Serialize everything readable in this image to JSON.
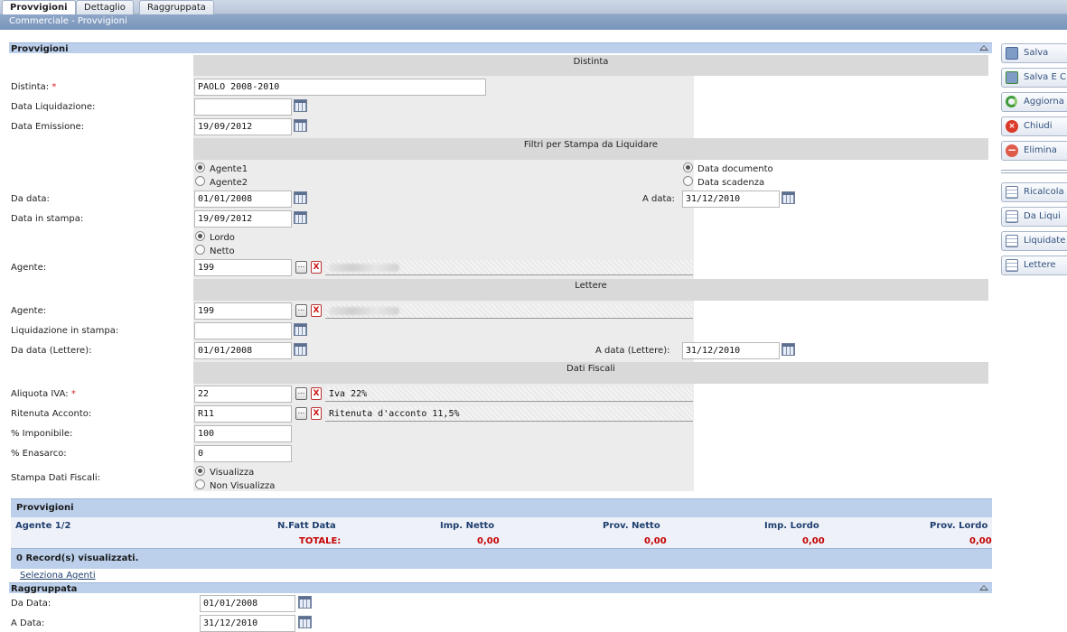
{
  "tabs": [
    {
      "label": "Provvigioni"
    },
    {
      "label": "Dettaglio"
    },
    {
      "label": "Raggruppata"
    }
  ],
  "breadcrumb": "Commerciale - Provvigioni",
  "section_provvigioni": {
    "title": "Provvigioni"
  },
  "groups": {
    "distinta": "Distinta",
    "filtri": "Filtri per Stampa da Liquidare",
    "lettere": "Lettere",
    "dati_fiscali": "Dati Fiscali"
  },
  "form": {
    "distinta_label": "Distinta:",
    "distinta_value": "PAOLO 2008-2010",
    "data_liquidazione_label": "Data Liquidazione:",
    "data_liquidazione_value": "",
    "data_emissione_label": "Data Emissione:",
    "data_emissione_value": "19/09/2012",
    "agente1_label": "Agente1",
    "agente2_label": "Agente2",
    "data_documento_label": "Data documento",
    "data_scadenza_label": "Data scadenza",
    "da_data_label": "Da data:",
    "da_data_value": "01/01/2008",
    "a_data_label": "A data:",
    "a_data_value": "31/12/2010",
    "data_in_stampa_label": "Data in stampa:",
    "data_in_stampa_value": "19/09/2012",
    "lordo_label": "Lordo",
    "netto_label": "Netto",
    "agente_label": "Agente:",
    "agente_value": "199",
    "lettere_agente_label": "Agente:",
    "lettere_agente_value": "199",
    "liquidazione_stampa_label": "Liquidazione in stampa:",
    "liquidazione_stampa_value": "",
    "da_data_lettere_label": "Da data (Lettere):",
    "da_data_lettere_value": "01/01/2008",
    "a_data_lettere_label": "A data (Lettere):",
    "a_data_lettere_value": "31/12/2010",
    "aliquota_iva_label": "Aliquota IVA:",
    "aliquota_iva_value": "22",
    "aliquota_iva_descr": "Iva 22%",
    "ritenuta_label": "Ritenuta Acconto:",
    "ritenuta_value": "R11",
    "ritenuta_descr": "Ritenuta d'acconto 11,5%",
    "imponibile_label": "% Imponibile:",
    "imponibile_value": "100",
    "enasarco_label": "% Enasarco:",
    "enasarco_value": "0",
    "stampa_dati_label": "Stampa Dati Fiscali:",
    "visualizza_label": "Visualizza",
    "non_visualizza_label": "Non Visualizza",
    "required_mark": "*",
    "lookup_glyph": "...",
    "clear_glyph": "X"
  },
  "grid": {
    "title": "Provvigioni",
    "columns": [
      "Agente 1/2",
      "N.Fatt Data",
      "Imp. Netto",
      "Prov. Netto",
      "Imp. Lordo",
      "Prov. Lordo"
    ],
    "totals_label": "TOTALE:",
    "totals": [
      "0,00",
      "0,00",
      "0,00",
      "0,00"
    ],
    "records_text": "0 Record(s) visualizzati.",
    "select_link": "Seleziona Agenti"
  },
  "section_raggruppata": {
    "title": "Raggruppata",
    "da_data_label": "Da Data:",
    "da_data_value": "01/01/2008",
    "a_data_label": "A Data:",
    "a_data_value": "31/12/2010"
  },
  "toolbar": {
    "buttons": [
      {
        "label": "Salva",
        "icon": "floppy-icon"
      },
      {
        "label": "Salva E C",
        "icon": "floppy-plus-icon"
      },
      {
        "label": "Aggiorna",
        "icon": "refresh-icon"
      },
      {
        "label": "Chiudi",
        "icon": "close-icon"
      },
      {
        "label": "Elimina",
        "icon": "delete-icon"
      },
      {
        "label": "Ricalcola",
        "icon": "grid-icon"
      },
      {
        "label": "Da Liqui",
        "icon": "grid-icon"
      },
      {
        "label": "Liquidate",
        "icon": "grid-icon"
      },
      {
        "label": "Lettere",
        "icon": "grid-icon"
      }
    ]
  },
  "colors": {
    "section_bar": "#bcd0ec",
    "tab_bar": "#b9c6da",
    "breadcrumb_bar": "#7a95bb",
    "totals": "#c40000",
    "required": "#dd2222"
  }
}
